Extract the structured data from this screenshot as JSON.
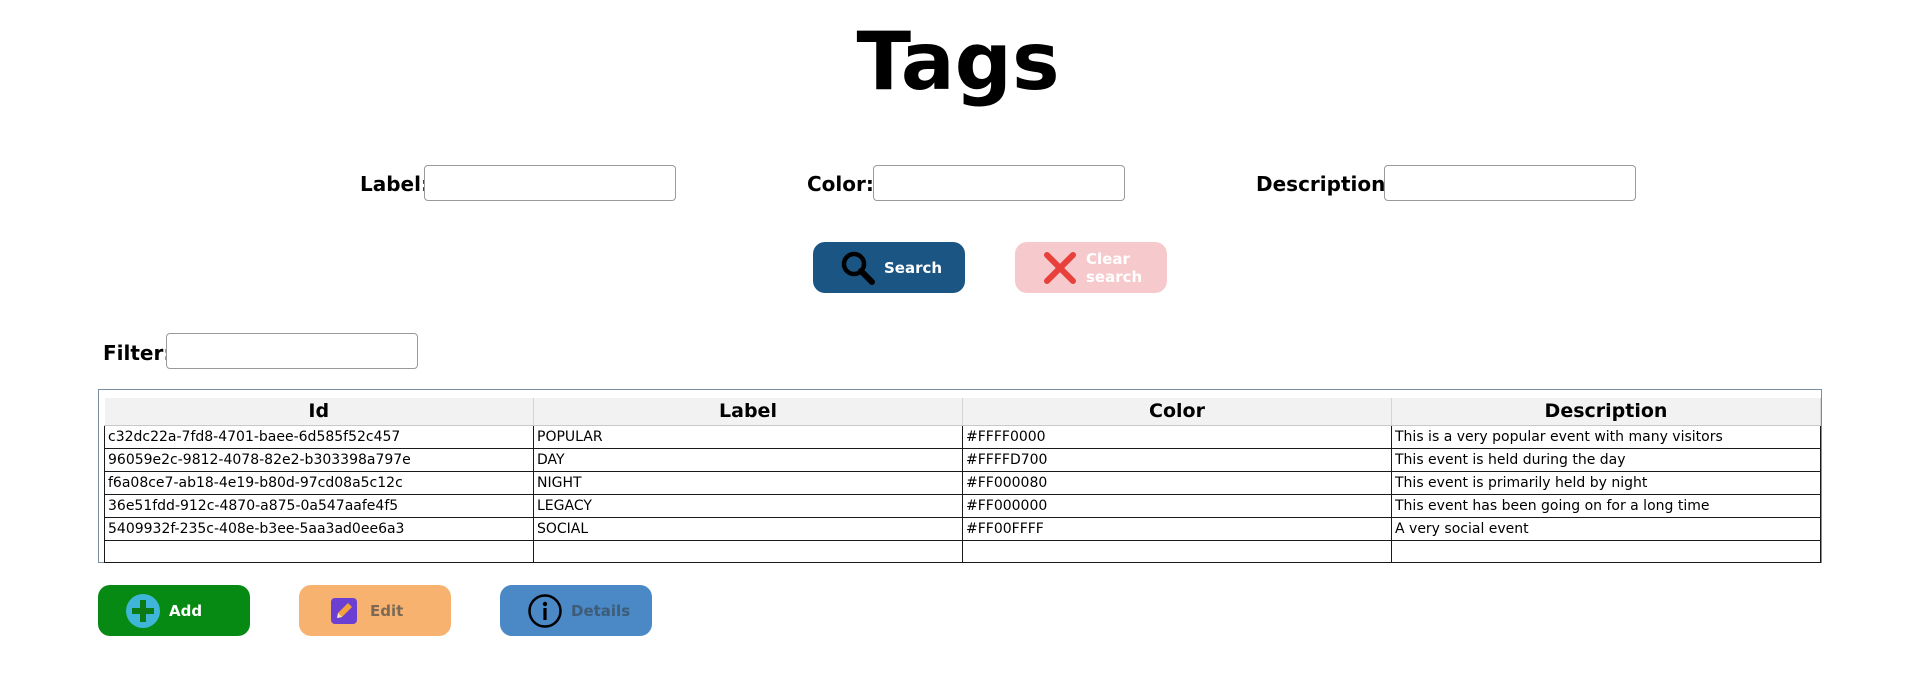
{
  "page": {
    "title": "Tags"
  },
  "search_form": {
    "label_field": {
      "label": "Label:",
      "value": "",
      "placeholder": ""
    },
    "color_field": {
      "label": "Color:",
      "value": "",
      "placeholder": ""
    },
    "description_field": {
      "label": "Description:",
      "value": "",
      "placeholder": ""
    },
    "search_button": {
      "label": "Search",
      "icon": "magnifier-icon"
    },
    "clear_button": {
      "label": "Clear search",
      "icon": "x-icon",
      "enabled": false
    }
  },
  "filter": {
    "label": "Filter:",
    "value": "",
    "placeholder": ""
  },
  "grid": {
    "columns": [
      "Id",
      "Label",
      "Color",
      "Description"
    ],
    "rows": [
      [
        "c32dc22a-7fd8-4701-baee-6d585f52c457",
        "POPULAR",
        "#FFFF0000",
        "This is a very popular event with many visitors"
      ],
      [
        "96059e2c-9812-4078-82e2-b303398a797e",
        "DAY",
        "#FFFFD700",
        "This event is held during the day"
      ],
      [
        "f6a08ce7-ab18-4e19-b80d-97cd08a5c12c",
        "NIGHT",
        "#FF000080",
        "This event is primarily held by night"
      ],
      [
        "36e51fdd-912c-4870-a875-0a547aafe4f5",
        "LEGACY",
        "#FF000000",
        "This event has been going on for a long time"
      ],
      [
        "5409932f-235c-408e-b3ee-5aa3ad0ee6a3",
        "SOCIAL",
        "#FF00FFFF",
        "A very social event"
      ],
      [
        "",
        "",
        "",
        ""
      ]
    ]
  },
  "actions": {
    "add": {
      "label": "Add",
      "icon": "plus-circle-icon"
    },
    "edit": {
      "label": "Edit",
      "icon": "pencil-icon",
      "enabled": false
    },
    "details": {
      "label": "Details",
      "icon": "info-icon",
      "enabled": false
    }
  },
  "colors": {
    "search_button": "#1b5583",
    "clear_button_disabled": "#f6c9cc",
    "add_button": "#078a13",
    "edit_button_disabled": "#f6b26e",
    "details_button_disabled": "#4a88c6"
  }
}
